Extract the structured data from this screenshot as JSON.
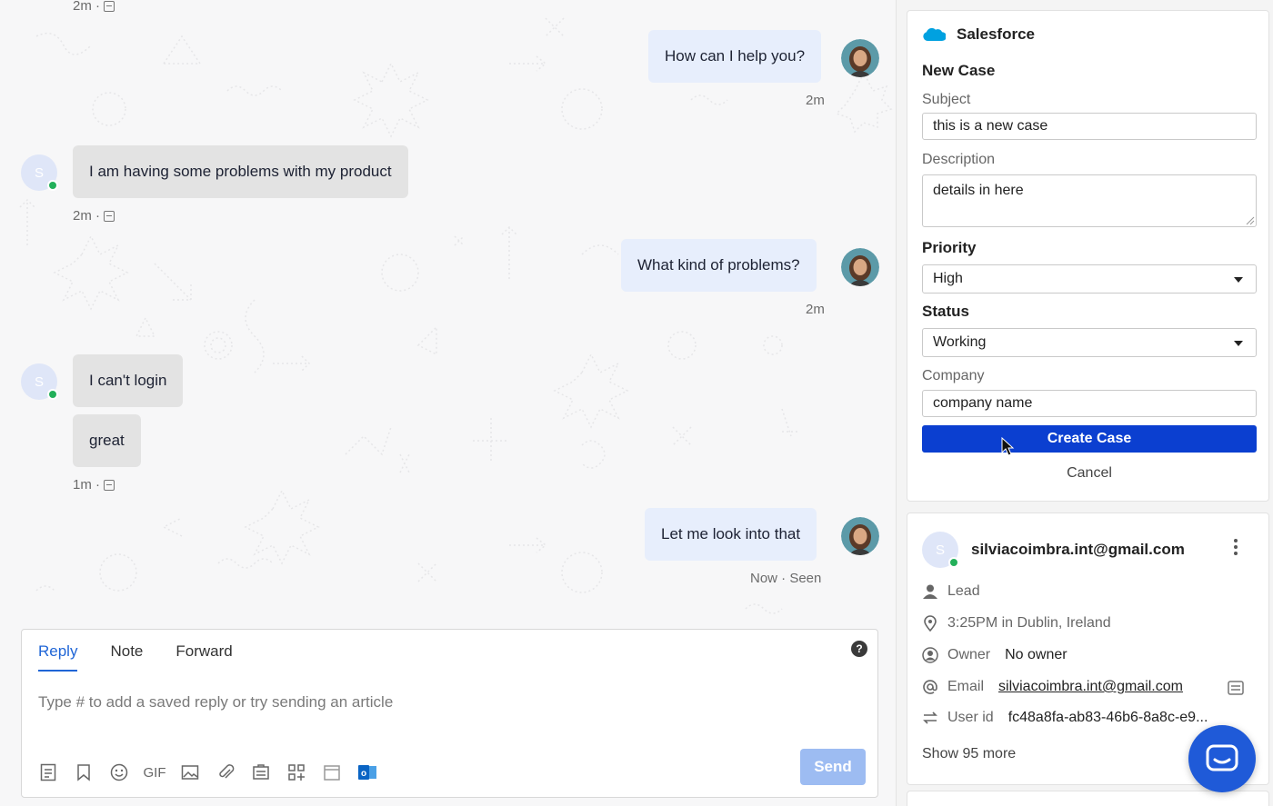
{
  "conversation": {
    "messages": [
      {
        "author": "agent",
        "text": "How can I help you?",
        "time": "2m"
      },
      {
        "author": "user",
        "avatar": "S",
        "text": "I am having some problems with my product",
        "time": "2m ·"
      },
      {
        "author": "agent",
        "text": "What kind of problems?",
        "time": "2m"
      },
      {
        "author": "user",
        "avatar": "S",
        "text": "I can't login"
      },
      {
        "author": "user",
        "text": "great",
        "time": "1m ·"
      },
      {
        "author": "agent",
        "text": "Let me look into that",
        "time": "Now · Seen"
      }
    ],
    "top_partial_time": "2m ·"
  },
  "composer": {
    "tabs": [
      "Reply",
      "Note",
      "Forward"
    ],
    "active_tab": "Reply",
    "help_label": "?",
    "placeholder": "Type # to add a saved reply or try sending an article",
    "tools": [
      "articles-icon",
      "bookmark-icon",
      "emoji-icon",
      "gif",
      "image-icon",
      "attachment-icon",
      "inbox-app-icon",
      "apps-icon",
      "calendar-icon",
      "outlook-icon"
    ],
    "gif_label": "GIF",
    "outlook_label": "o",
    "send_label": "Send"
  },
  "salesforce": {
    "title": "Salesforce",
    "form_title": "New Case",
    "subject_label": "Subject",
    "subject_value": "this is a new case",
    "description_label": "Description",
    "description_value": "details in here",
    "priority_label": "Priority",
    "priority_value": "High",
    "status_label": "Status",
    "status_value": "Working",
    "company_label": "Company",
    "company_value": "company name",
    "create_label": "Create Case",
    "cancel_label": "Cancel",
    "brand_color": "#00a1e0"
  },
  "contact": {
    "avatar": "S",
    "email_heading": "silviacoimbra.int@gmail.com",
    "role": "Lead",
    "location": "3:25PM in Dublin, Ireland",
    "owner_label": "Owner",
    "owner_value": "No owner",
    "email_label": "Email",
    "email_value": "silviacoimbra.int@gmail.com",
    "userid_label": "User id",
    "userid_value": "fc48a8fa-ab83-46b6-8a8c-e9...",
    "show_more": "Show 95 more"
  },
  "colors": {
    "accent": "#1f65d6",
    "create_button": "#0b3fd0",
    "online": "#23b05a",
    "messenger": "#1f5ad8"
  }
}
